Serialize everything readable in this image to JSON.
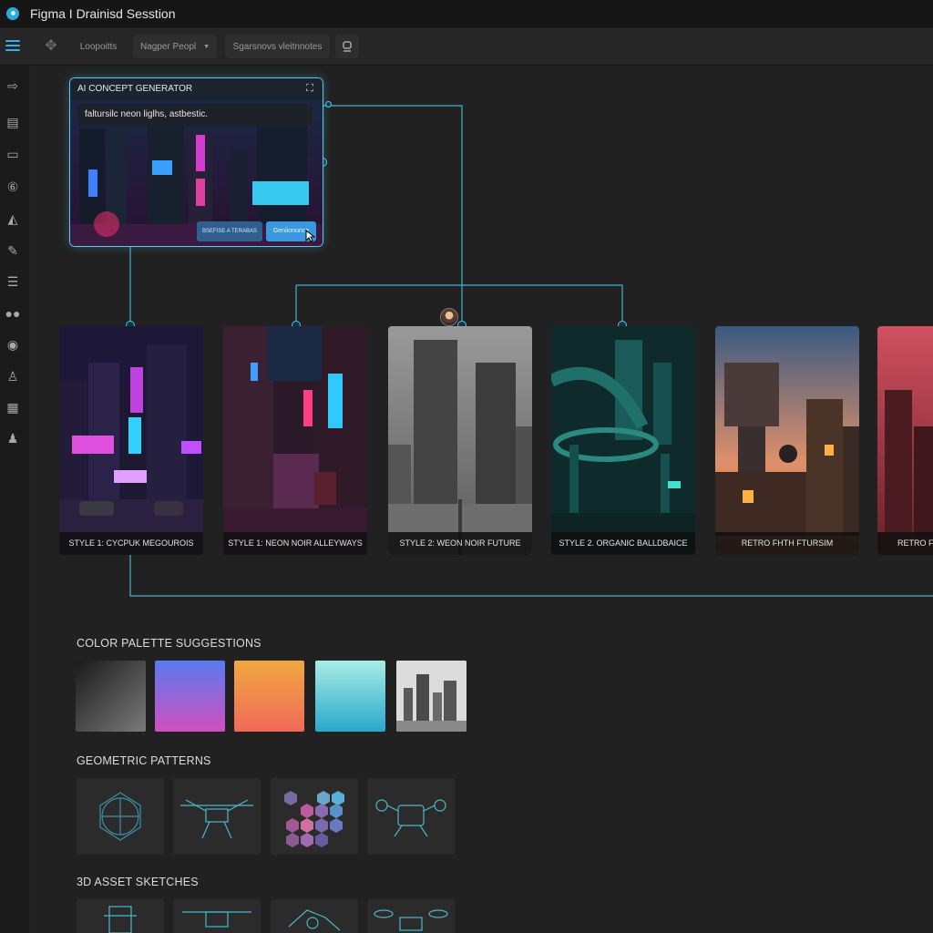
{
  "window": {
    "title": "Figma I Drainisd Sesstion"
  },
  "toolbar": {
    "items": [
      "Loopoitts",
      "Nagper Peopl",
      "Sgarsnovs vleitnnotes"
    ]
  },
  "sidebar": {
    "icons": [
      "arrow-right-icon",
      "document-icon",
      "monitor-icon",
      "number-six-icon",
      "shape-icon",
      "pen-icon",
      "list-icon",
      "users-icon",
      "circle-badge-icon",
      "person-icon",
      "calendar-icon",
      "user-icon"
    ]
  },
  "generator": {
    "title": "AI CONCEPT GENERATOR",
    "prompt": "faltursilc neon liglhs, astbestic.",
    "secondary_button": "BSEFISE A TERABAS",
    "primary_button": "Geniionunce"
  },
  "styles": [
    {
      "caption": "STYLE 1: CYCPUK MEGOUROIS"
    },
    {
      "caption": "STYLE 1: NEON NOIR ALLEYWAYS"
    },
    {
      "caption": "STYLE 2: WEON NOIR FUTURE"
    },
    {
      "caption": "STYLE 2. ORGANIC BALLDBAICE"
    },
    {
      "caption": "RETRO FHTH FTURSIM"
    },
    {
      "caption": "RETRO FI"
    }
  ],
  "palette": {
    "title": "COLOR PALETTE SUGGESTIONS",
    "colors": [
      "#2a2a2a",
      "#8e5bd8",
      "#f08a4a",
      "#5ecad6",
      "#cfcfcf"
    ]
  },
  "patterns": {
    "title": "GEOMETRIC PATTERNS"
  },
  "sketches": {
    "title": "3D ASSET SKETCHES"
  },
  "colors": {
    "accent": "#5bc4e6",
    "primary_button": "#3a98e0"
  }
}
